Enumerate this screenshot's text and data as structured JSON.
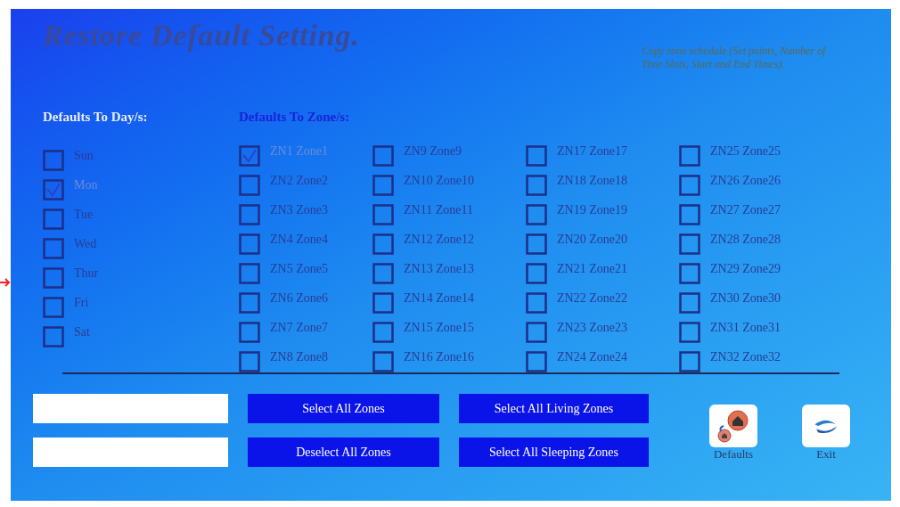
{
  "title": "Restore Default Setting.",
  "copy_note": "Copy zone schedule (Set points, Number of Time Slots, Start and End Times).",
  "days_heading": "Defaults To Day/s:",
  "zones_heading": "Defaults To Zone/s:",
  "days": [
    {
      "label": "Sun",
      "checked": false
    },
    {
      "label": "Mon",
      "checked": true
    },
    {
      "label": "Tue",
      "checked": false
    },
    {
      "label": "Wed",
      "checked": false
    },
    {
      "label": "Thur",
      "checked": false
    },
    {
      "label": "Fri",
      "checked": false
    },
    {
      "label": "Sat",
      "checked": false
    }
  ],
  "zones": [
    {
      "label": "ZN1 Zone1",
      "checked": true
    },
    {
      "label": "ZN2 Zone2",
      "checked": false
    },
    {
      "label": "ZN3 Zone3",
      "checked": false
    },
    {
      "label": "ZN4 Zone4",
      "checked": false
    },
    {
      "label": "ZN5 Zone5",
      "checked": false
    },
    {
      "label": "ZN6 Zone6",
      "checked": false
    },
    {
      "label": "ZN7 Zone7",
      "checked": false
    },
    {
      "label": "ZN8 Zone8",
      "checked": false
    },
    {
      "label": "ZN9 Zone9",
      "checked": false
    },
    {
      "label": "ZN10 Zone10",
      "checked": false
    },
    {
      "label": "ZN11 Zone11",
      "checked": false
    },
    {
      "label": "ZN12 Zone12",
      "checked": false
    },
    {
      "label": "ZN13 Zone13",
      "checked": false
    },
    {
      "label": "ZN14 Zone14",
      "checked": false
    },
    {
      "label": "ZN15 Zone15",
      "checked": false
    },
    {
      "label": "ZN16 Zone16",
      "checked": false
    },
    {
      "label": "ZN17 Zone17",
      "checked": false
    },
    {
      "label": "ZN18 Zone18",
      "checked": false
    },
    {
      "label": "ZN19 Zone19",
      "checked": false
    },
    {
      "label": "ZN20 Zone20",
      "checked": false
    },
    {
      "label": "ZN21 Zone21",
      "checked": false
    },
    {
      "label": "ZN22 Zone22",
      "checked": false
    },
    {
      "label": "ZN23 Zone23",
      "checked": false
    },
    {
      "label": "ZN24 Zone24",
      "checked": false
    },
    {
      "label": "ZN25 Zone25",
      "checked": false
    },
    {
      "label": "ZN26 Zone26",
      "checked": false
    },
    {
      "label": "ZN27 Zone27",
      "checked": false
    },
    {
      "label": "ZN28 Zone28",
      "checked": false
    },
    {
      "label": "ZN29 Zone29",
      "checked": false
    },
    {
      "label": "ZN30 Zone30",
      "checked": false
    },
    {
      "label": "ZN31 Zone31",
      "checked": false
    },
    {
      "label": "ZN32 Zone32",
      "checked": false
    }
  ],
  "buttons": [
    "Select All Zones",
    "Select All Living Zones",
    "Deselect All Zones",
    "Select All Sleeping Zones"
  ],
  "icon_buttons": [
    {
      "kind": "defaults",
      "label": "Defaults"
    },
    {
      "kind": "exit",
      "label": "Exit"
    }
  ]
}
